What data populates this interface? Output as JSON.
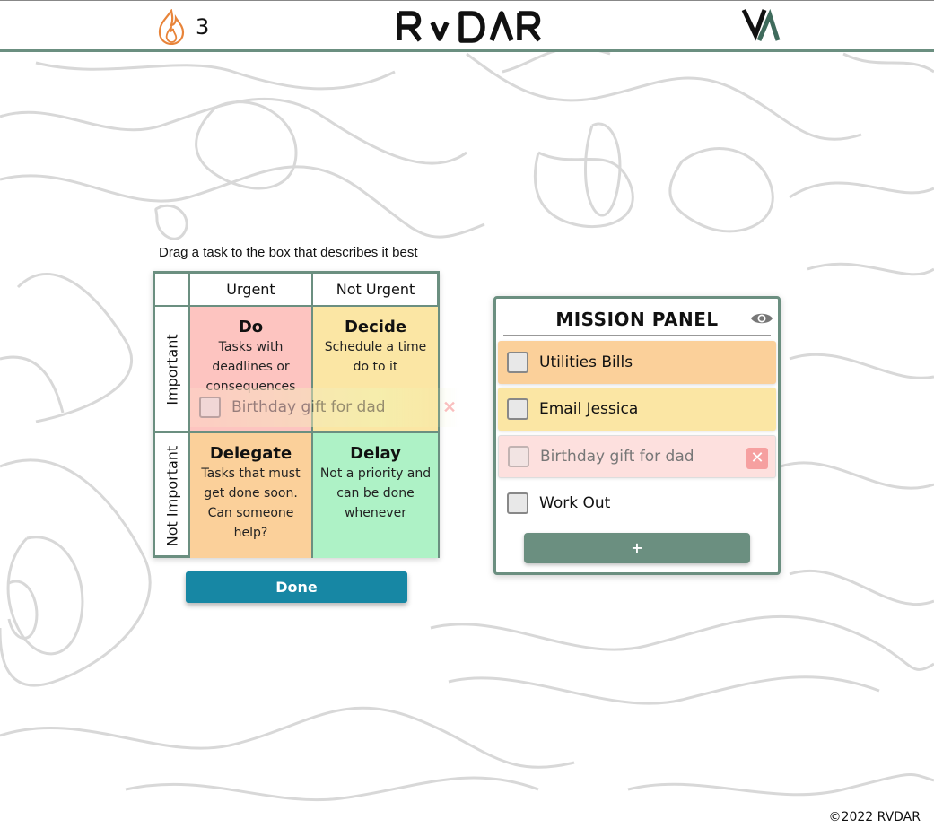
{
  "header": {
    "streak_count": "3",
    "brand": "RVDAR"
  },
  "instruction": "Drag a task to the box that describes it best",
  "matrix": {
    "columns": [
      "Urgent",
      "Not Urgent"
    ],
    "rows": [
      "Important",
      "Not Important"
    ],
    "quadrants": [
      {
        "title": "Do",
        "description": "Tasks with deadlines or consequences",
        "color": "#fdc4c0"
      },
      {
        "title": "Decide",
        "description": "Schedule a time do to it",
        "color": "#fbe6a4"
      },
      {
        "title": "Delegate",
        "description": "Tasks that must get done soon. Can someone help?",
        "color": "#fbd09a"
      },
      {
        "title": "Delay",
        "description": "Not a priority and can be done whenever",
        "color": "#aef2c6"
      }
    ]
  },
  "dragging_task": {
    "label": "Birthday gift for dad"
  },
  "done_label": "Done",
  "mission_panel": {
    "title": "MISSION PANEL",
    "tasks": [
      {
        "label": "Utilities Bills",
        "checked": false,
        "color": "#fbd09a"
      },
      {
        "label": "Email Jessica",
        "checked": false,
        "color": "#fbe6a4"
      },
      {
        "label": "Birthday gift for dad",
        "checked": false,
        "color": "#fde0de",
        "state": "dragging"
      },
      {
        "label": "Work Out",
        "checked": false,
        "color": "#ffffff"
      }
    ],
    "add_label": "+"
  },
  "footer": "©2022 RVDAR",
  "colors": {
    "accent": "#6b8f80",
    "done_button": "#1787a4",
    "flame": "#e8843a"
  }
}
